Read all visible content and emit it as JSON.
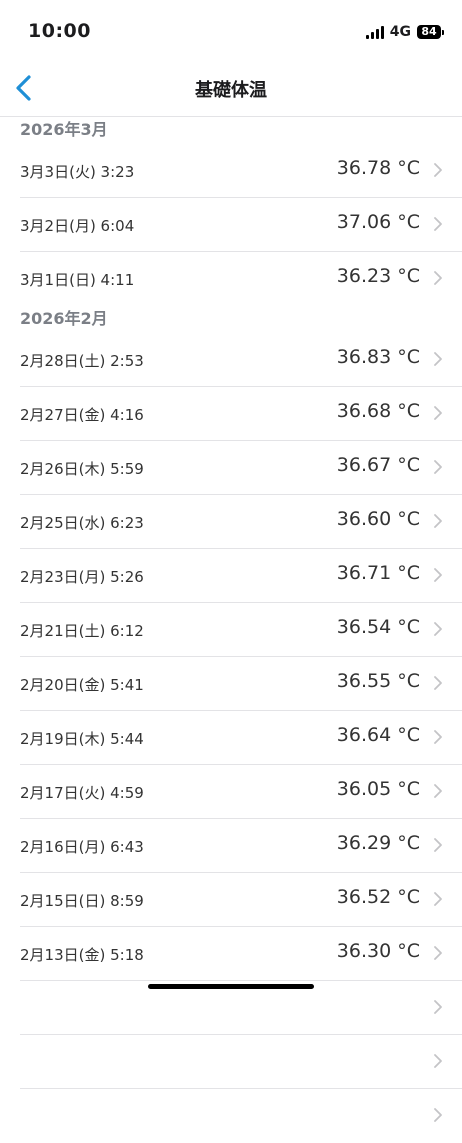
{
  "status_bar": {
    "time": "10:00",
    "network": "4G",
    "battery": "84"
  },
  "nav": {
    "title": "基礎体温"
  },
  "colors": {
    "accent": "#1f8fd6",
    "section_header": "#7b7f86",
    "divider": "#e3e3e6",
    "chevron": "#c4c4c7"
  },
  "sections": [
    {
      "header": "2026年3月",
      "rows": [
        {
          "datetime": "3月3日(火) 3:23",
          "temperature": "36.78 °C"
        },
        {
          "datetime": "3月2日(月) 6:04",
          "temperature": "37.06 °C"
        },
        {
          "datetime": "3月1日(日) 4:11",
          "temperature": "36.23 °C"
        }
      ]
    },
    {
      "header": "2026年2月",
      "rows": [
        {
          "datetime": "2月28日(土) 2:53",
          "temperature": "36.83 °C"
        },
        {
          "datetime": "2月27日(金) 4:16",
          "temperature": "36.68 °C"
        },
        {
          "datetime": "2月26日(木) 5:59",
          "temperature": "36.67 °C"
        },
        {
          "datetime": "2月25日(水) 6:23",
          "temperature": "36.60 °C"
        },
        {
          "datetime": "2月23日(月) 5:26",
          "temperature": "36.71 °C"
        },
        {
          "datetime": "2月21日(土) 6:12",
          "temperature": "36.54 °C"
        },
        {
          "datetime": "2月20日(金) 5:41",
          "temperature": "36.55 °C"
        },
        {
          "datetime": "2月19日(木) 5:44",
          "temperature": "36.64 °C"
        },
        {
          "datetime": "2月17日(火) 4:59",
          "temperature": "36.05 °C"
        },
        {
          "datetime": "2月16日(月) 6:43",
          "temperature": "36.29 °C"
        },
        {
          "datetime": "2月15日(日) 8:59",
          "temperature": "36.52 °C"
        },
        {
          "datetime": "2月13日(金) 5:18",
          "temperature": "36.30 °C"
        }
      ]
    }
  ]
}
